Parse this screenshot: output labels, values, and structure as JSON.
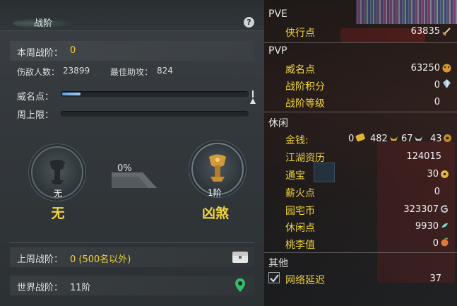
{
  "left": {
    "title": "战阶",
    "help": "?",
    "this_week": {
      "label": "本周战阶：",
      "value": "0"
    },
    "stats": {
      "kill_label": "伤敌人数：",
      "kill_value": "23899",
      "assist_label": "最佳助攻：",
      "assist_value": "824"
    },
    "weiming": {
      "label": "威名点：",
      "progress": 0.1
    },
    "weekly_cap": {
      "label": "周上限：",
      "progress": 0
    },
    "current_rank": {
      "number": "无",
      "name": "无"
    },
    "next_rank": {
      "number": "1阶",
      "name": "凶煞"
    },
    "progress_pct": "0%",
    "last_week": {
      "label": "上周战阶：",
      "value": "0 (500名以外)"
    },
    "world": {
      "label": "世界战阶：",
      "value": "11阶"
    }
  },
  "right": {
    "pve": {
      "header": "PVE",
      "xiaxing_label": "侠行点",
      "xiaxing_value": "63835"
    },
    "pvp": {
      "header": "PVP",
      "weiming_label": "威名点",
      "weiming_value": "63250",
      "zhanjie_score_label": "战阶积分",
      "zhanjie_score_value": "0",
      "zhanjie_level_label": "战阶等级",
      "zhanjie_level_value": "0"
    },
    "leisure": {
      "header": "休闲",
      "money_label": "金钱:",
      "money_zero": "0",
      "money_gold": "482",
      "money_silver": "67",
      "money_copper": "43",
      "jianghu_label": "江湖资历",
      "jianghu_value": "124015",
      "tongbao_label": "通宝",
      "tongbao_value": "30",
      "xinhuo_label": "薪火点",
      "xinhuo_value": "0",
      "yuanzhai_label": "园宅币",
      "yuanzhai_value": "323307",
      "xiuxian_label": "休闲点",
      "xiuxian_value": "9930",
      "taoli_label": "桃李值",
      "taoli_value": "0"
    },
    "other": {
      "header": "其他",
      "latency_label": "网络延迟",
      "latency_value": "37",
      "latency_checked": true
    }
  }
}
